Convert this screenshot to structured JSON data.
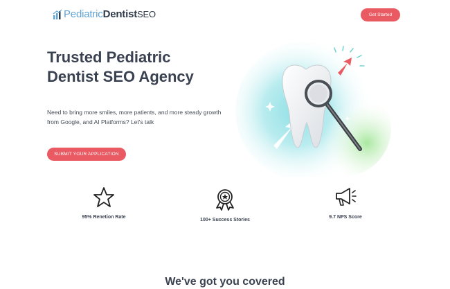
{
  "header": {
    "logo_part1": "Pediatric",
    "logo_part2": "Dentist",
    "logo_part3": "SEO",
    "logo_icon": "bar-chart-growth-icon",
    "cta_label": "Get Started"
  },
  "hero": {
    "title_line1": "Trusted Pediatric",
    "title_line2": "Dentist SEO Agency",
    "description": "Need to bring more smiles, more patients, and more steady growth from Google, and AI Platforms? Let's talk",
    "button_label": "SUBMIT YOUR APPLICATION",
    "illustration": "tooth-magnifying-glass-illustration"
  },
  "stats": [
    {
      "icon": "star-icon",
      "label": "95% Renetion Rate"
    },
    {
      "icon": "award-ribbon-icon",
      "label": "100+ Success Stories"
    },
    {
      "icon": "megaphone-icon",
      "label": "9.7 NPS Score"
    }
  ],
  "next_section": {
    "title": "We've got you covered"
  },
  "colors": {
    "accent": "#ea5a63",
    "logo_blue": "#5fa4d6",
    "text_dark": "#3a4150"
  }
}
